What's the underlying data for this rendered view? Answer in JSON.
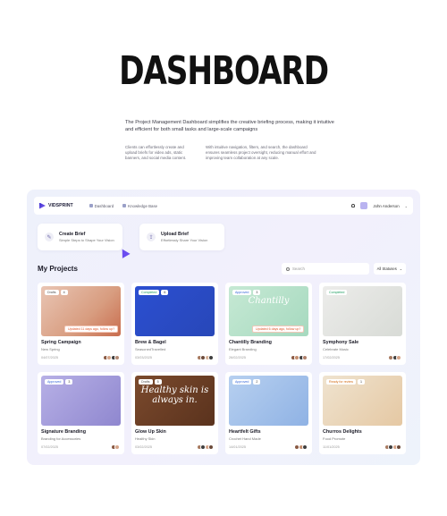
{
  "hero": {
    "title": "DASHBOARD",
    "lead": "The Project Management Dashboard simplifies the creative briefing process, making it intuitive and efficient for both small tasks and large-scale campaigns",
    "col1": "Clients can effortlessly create and upload briefs for video ads, static banners, and social media content.",
    "col2": "With intuitive navigation, filters, and search, the dashboard ensures seamless project oversight, reducing manual effort and improving team collaboration at any scale."
  },
  "topbar": {
    "brand": "VIDSPRINT",
    "nav": [
      {
        "label": "Dashboard"
      },
      {
        "label": "Knowledge Base"
      }
    ],
    "user": "John Anderson"
  },
  "briefs": [
    {
      "title": "Create Brief",
      "subtitle": "Simple Steps to Shape Your Vision"
    },
    {
      "title": "Upload Brief",
      "subtitle": "Effortlessly Share Your Vision"
    }
  ],
  "projects": {
    "title": "My Projects",
    "search_placeholder": "Search",
    "status_filter": "All Statuses",
    "cards": [
      {
        "status": "Drafts",
        "count": "4",
        "title": "Spring Campaign",
        "subtitle": "New Spring",
        "date": "04/07/2025",
        "updated": "Updated 11 days ago, follow up?",
        "thumb": "",
        "bg": "bg-spring",
        "pill_class": "drafts",
        "team": [
          "#8a5a44",
          "#d6a58a",
          "#3e3e3e",
          "#b48a74"
        ]
      },
      {
        "status": "Completed",
        "count": "6",
        "title": "Brew & Bagel",
        "subtitle": "SeasonedTravelled",
        "date": "03/03/2025",
        "updated": "",
        "thumb": "",
        "bg": "bg-brew",
        "pill_class": "completed",
        "team": [
          "#a87a60",
          "#6b4a3a",
          "#d8b39a",
          "#3d3d3d"
        ]
      },
      {
        "status": "Approved",
        "count": "3",
        "title": "Chantilly Branding",
        "subtitle": "Elegant Branding",
        "date": "26/02/2025",
        "updated": "Updated 6 days ago, follow up?",
        "thumb": "Chantilly",
        "bg": "bg-chantilly",
        "pill_class": "approved",
        "team": [
          "#8a5a44",
          "#c48e6e",
          "#3e3e3e",
          "#b0806a"
        ]
      },
      {
        "status": "Completed",
        "count": "",
        "title": "Symphony Sale",
        "subtitle": "Celebrate Music",
        "date": "17/02/2025",
        "updated": "",
        "thumb": "",
        "bg": "bg-symphony",
        "pill_class": "completed",
        "team": [
          "#a87a60",
          "#3e3e3e",
          "#d6a58a"
        ]
      },
      {
        "status": "Approved",
        "count": "3",
        "title": "Signature Branding",
        "subtitle": "Branding for Accessories",
        "date": "07/02/2025",
        "updated": "",
        "thumb": "",
        "bg": "bg-signature",
        "pill_class": "approved",
        "team": [
          "#8a5a44",
          "#d6a58a"
        ]
      },
      {
        "status": "Drafts",
        "count": "5",
        "title": "Glow Up Skin",
        "subtitle": "Healthy Skin",
        "date": "03/02/2025",
        "updated": "",
        "thumb": "Healthy skin is always in.",
        "bg": "bg-glow",
        "pill_class": "drafts",
        "team": [
          "#a87a60",
          "#3e3e3e",
          "#d6a58a",
          "#6b4a3a"
        ]
      },
      {
        "status": "Approved",
        "count": "2",
        "title": "Heartfelt Gifts",
        "subtitle": "Crochet Hand Made",
        "date": "14/01/2025",
        "updated": "",
        "thumb": "",
        "bg": "bg-heartfelt",
        "pill_class": "approved",
        "team": [
          "#8a5a44",
          "#c48e6e",
          "#3e3e3e"
        ]
      },
      {
        "status": "Ready for review",
        "count": "1",
        "title": "Churros Delights",
        "subtitle": "Food Promote",
        "date": "11/01/2025",
        "updated": "",
        "thumb": "",
        "bg": "bg-churros",
        "pill_class": "ready",
        "team": [
          "#a87a60",
          "#3e3e3e",
          "#d6a58a",
          "#6b4a3a"
        ]
      }
    ]
  }
}
